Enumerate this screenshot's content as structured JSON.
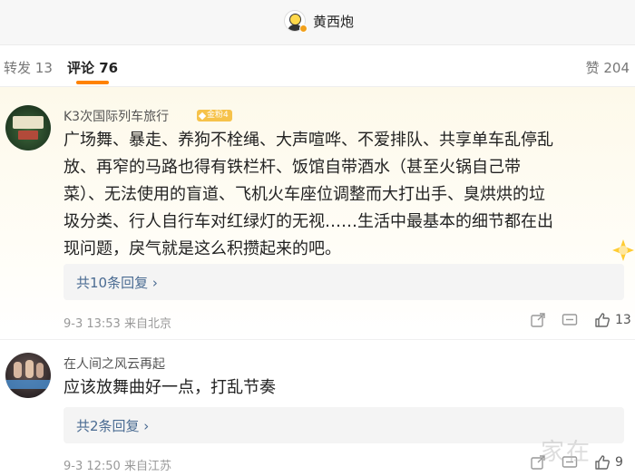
{
  "header": {
    "title": "黄西炮",
    "avatar_icon": "smiley-avatar-icon",
    "verify_color": "#f1a01b"
  },
  "tabs": {
    "repost": {
      "label": "转发",
      "count": "13"
    },
    "comment": {
      "label": "评论",
      "count": "76"
    },
    "like": {
      "label": "赞",
      "count": "204"
    },
    "accent": "#ff8200"
  },
  "comments": [
    {
      "user": "K3次国际列车旅行",
      "badge": "金粉4",
      "lines": [
        "广场舞、暴走、养狗不栓绳、大声喧哗、不爱排队、共享单车乱停乱",
        "放、再窄的马路也得有铁栏杆、饭馆自带酒水（甚至火锅自己带",
        "菜）、无法使用的盲道、飞机火车座位调整而大打出手、臭烘烘的垃",
        "圾分类、行人自行车对红绿灯的无视……生活中最基本的细节都在出",
        "现问题，戾气就是这么积攒起来的吧。"
      ],
      "replies": "共10条回复 ›",
      "meta": "9-3 13:53 来自北京",
      "likes": "13"
    },
    {
      "user": "在人间之风云再起",
      "lines": [
        "应该放舞曲好一点，打乱节奏"
      ],
      "replies": "共2条回复 ›",
      "meta": "9-3 12:50 来自江苏",
      "likes": "9"
    }
  ],
  "watermark": "家在"
}
